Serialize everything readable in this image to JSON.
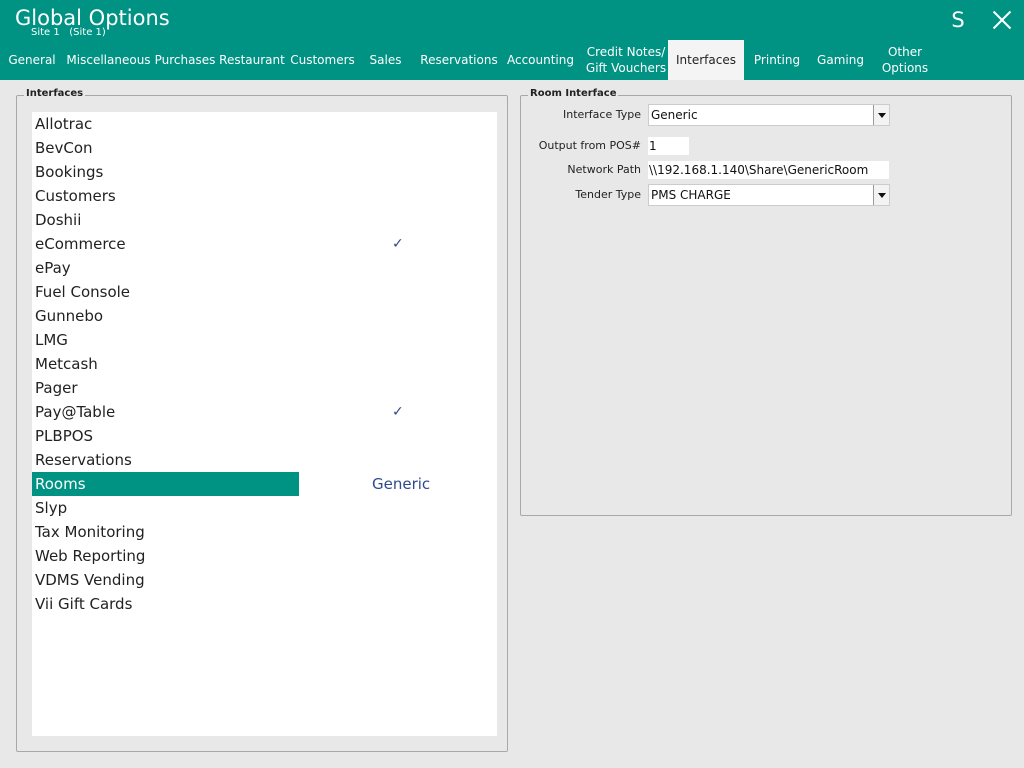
{
  "window": {
    "title": "Global Options",
    "subtitle": "Site 1   (Site 1)"
  },
  "header_buttons": {
    "s_label": "S"
  },
  "tabs": [
    {
      "label": "General"
    },
    {
      "label": "Miscellaneous"
    },
    {
      "label": "Purchases"
    },
    {
      "label": "Restaurant"
    },
    {
      "label": "Customers"
    },
    {
      "label": "Sales"
    },
    {
      "label": "Reservations"
    },
    {
      "label": "Accounting"
    },
    {
      "label": "Credit Notes/\nGift Vouchers"
    },
    {
      "label": "Interfaces",
      "active": true
    },
    {
      "label": "Printing"
    },
    {
      "label": "Gaming"
    },
    {
      "label": "Other\nOptions"
    }
  ],
  "interfaces_panel": {
    "label": "Interfaces",
    "items": [
      {
        "name": "Allotrac"
      },
      {
        "name": "BevCon"
      },
      {
        "name": "Bookings"
      },
      {
        "name": "Customers"
      },
      {
        "name": "Doshii"
      },
      {
        "name": "eCommerce",
        "check": "✓"
      },
      {
        "name": "ePay"
      },
      {
        "name": "Fuel Console"
      },
      {
        "name": "Gunnebo"
      },
      {
        "name": "LMG"
      },
      {
        "name": "Metcash"
      },
      {
        "name": "Pager"
      },
      {
        "name": "Pay@Table",
        "check": "✓"
      },
      {
        "name": "PLBPOS"
      },
      {
        "name": "Reservations"
      },
      {
        "name": "Rooms",
        "value": "Generic",
        "selected": true
      },
      {
        "name": "Slyp"
      },
      {
        "name": "Tax Monitoring"
      },
      {
        "name": "Web Reporting"
      },
      {
        "name": "VDMS Vending"
      },
      {
        "name": "Vii Gift Cards"
      }
    ]
  },
  "room_interface": {
    "label": "Room Interface",
    "interface_type": {
      "label": "Interface Type",
      "value": "Generic"
    },
    "output_pos": {
      "label": "Output from POS#",
      "value": "1"
    },
    "network_path": {
      "label": "Network Path",
      "value": "\\\\192.168.1.140\\Share\\GenericRoom"
    },
    "tender_type": {
      "label": "Tender Type",
      "value": "PMS CHARGE"
    }
  },
  "colors": {
    "brand": "#009383",
    "value_text": "#2f4a8a"
  }
}
